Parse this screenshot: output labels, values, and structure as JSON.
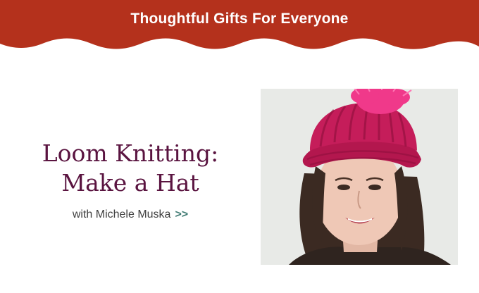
{
  "banner": {
    "text": "Thoughtful Gifts For Everyone",
    "color": "#b4311c"
  },
  "course": {
    "title_line1": "Loom Knitting:",
    "title_line2": "Make a Hat",
    "byline": "with Michele Muska",
    "chevrons": ">>",
    "title_color": "#5a1440",
    "accent_color": "#3e7a72"
  },
  "photo": {
    "icon": "portrait-photo",
    "subject": "woman-in-pink-knit-hat"
  }
}
